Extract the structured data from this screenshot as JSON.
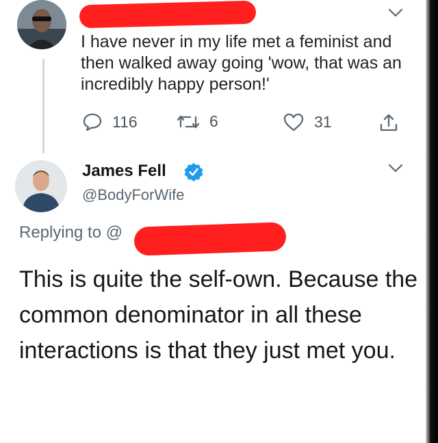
{
  "tweet1": {
    "text": "I have never in my life met a feminist and then walked away going 'wow, that was an incredibly happy person!'",
    "actions": {
      "reply_count": "116",
      "retweet_count": "6",
      "like_count": "31"
    }
  },
  "tweet2": {
    "display_name": "James Fell",
    "handle": "@BodyForWife",
    "replying_to_prefix": "Replying to @",
    "text": "This is quite the self-own. Because the common denominator in all these interactions is that they just met you."
  },
  "icons": {
    "reply": "comment-icon",
    "retweet": "retweet-icon",
    "like": "heart-icon",
    "share": "share-icon",
    "verified": "verified-badge-icon",
    "menu": "chevron-down-icon"
  },
  "colors": {
    "verified_blue": "#1d9bf0",
    "redaction_red": "#ff1f1f",
    "secondary_text": "#5b6670"
  }
}
